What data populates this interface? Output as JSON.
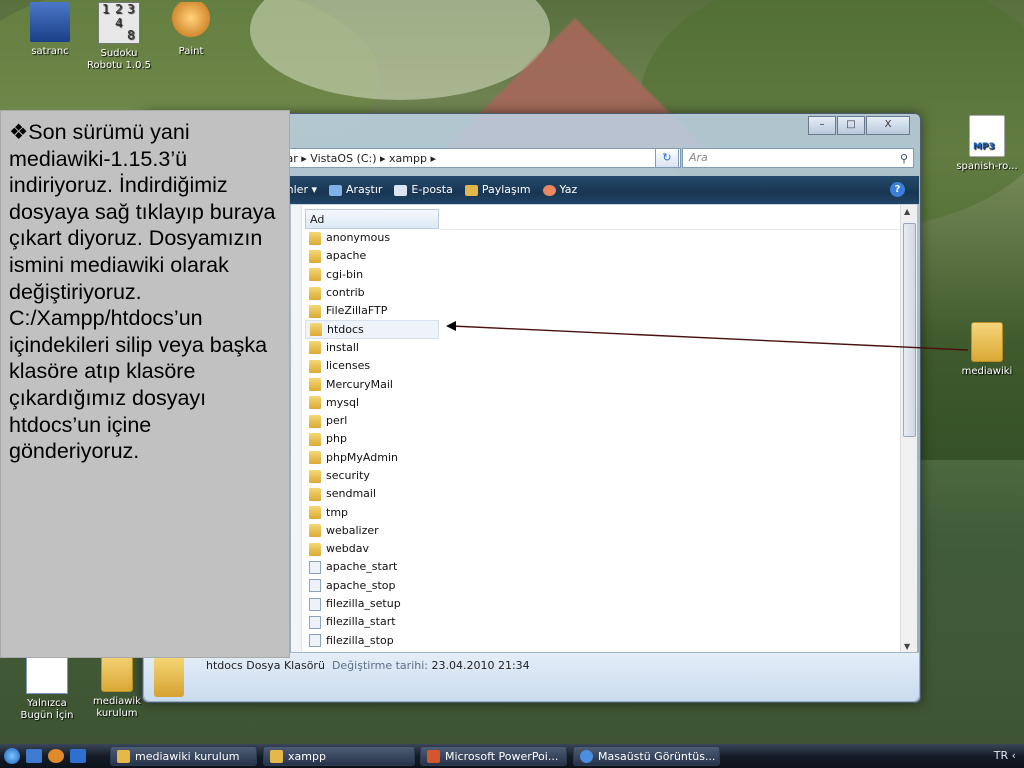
{
  "desktop": {
    "icons": {
      "satranc": "satranc",
      "sudoku_line1": "Sudoku",
      "sudoku_line2": "Robotu 1.0.5",
      "paint": "Paint",
      "mp3": "spanish-ro...",
      "mp3_badge": "MP3",
      "mediawiki_folder": "mediawiki",
      "yalnizca_line1": "Yalnızca",
      "yalnizca_line2": "Bugün İçin",
      "mediawiki_kurulum_line1": "mediawik",
      "mediawiki_kurulum_line2": "kurulum"
    },
    "sudoku_digits": [
      "1",
      "2",
      "3",
      "4",
      "8"
    ]
  },
  "window": {
    "controls": {
      "minimize": "–",
      "maximize": "□",
      "close": "X"
    },
    "address": "yar ▸ VistaOS (C:) ▸ xampp ▸",
    "search_placeholder": "Ara",
    "toolbar": [
      "ünümler ▾",
      "Araştır",
      "E-posta",
      "Paylaşım",
      "Yaz"
    ],
    "column_header": "Ad",
    "files": [
      {
        "name": "anonymous",
        "type": "folder"
      },
      {
        "name": "apache",
        "type": "folder"
      },
      {
        "name": "cgi-bin",
        "type": "folder"
      },
      {
        "name": "contrib",
        "type": "folder"
      },
      {
        "name": "FileZillaFTP",
        "type": "folder"
      },
      {
        "name": "htdocs",
        "type": "folder",
        "selected": true
      },
      {
        "name": "install",
        "type": "folder"
      },
      {
        "name": "licenses",
        "type": "folder"
      },
      {
        "name": "MercuryMail",
        "type": "folder"
      },
      {
        "name": "mysql",
        "type": "folder"
      },
      {
        "name": "perl",
        "type": "folder"
      },
      {
        "name": "php",
        "type": "folder"
      },
      {
        "name": "phpMyAdmin",
        "type": "folder"
      },
      {
        "name": "security",
        "type": "folder"
      },
      {
        "name": "sendmail",
        "type": "folder"
      },
      {
        "name": "tmp",
        "type": "folder"
      },
      {
        "name": "webalizer",
        "type": "folder"
      },
      {
        "name": "webdav",
        "type": "folder"
      },
      {
        "name": "apache_start",
        "type": "bat"
      },
      {
        "name": "apache_stop",
        "type": "bat"
      },
      {
        "name": "filezilla_setup",
        "type": "bat"
      },
      {
        "name": "filezilla_start",
        "type": "bat"
      },
      {
        "name": "filezilla_stop",
        "type": "bat"
      }
    ],
    "details": {
      "name": "htdocs",
      "type": "Dosya Klasörü",
      "modified_label": "Değiştirme tarihi:",
      "modified_value": "23.04.2010 21:34"
    }
  },
  "slide_text": "❖Son sürümü yani mediawiki-1.15.3’ü indiriyoruz. İndirdiğimiz dosyaya sağ tıklayıp buraya çıkart diyoruz. Dosyamızın ismini mediawiki olarak değiştiriyoruz. C:/Xampp/htdocs’un içindekileri silip veya başka klasöre atıp klasöre çıkardığımız dosyayı htdocs’un içine gönderiyoruz.",
  "taskbar": {
    "tasks": [
      "mediawiki kurulum",
      "xampp",
      "Microsoft PowerPoi...",
      "Masaüstü Görüntüs..."
    ],
    "tray": "TR  ‹"
  },
  "colors": {
    "slide_bg": "#c1c1c1",
    "toolbar_bg": "#183652",
    "arrow": "#4a1010"
  }
}
